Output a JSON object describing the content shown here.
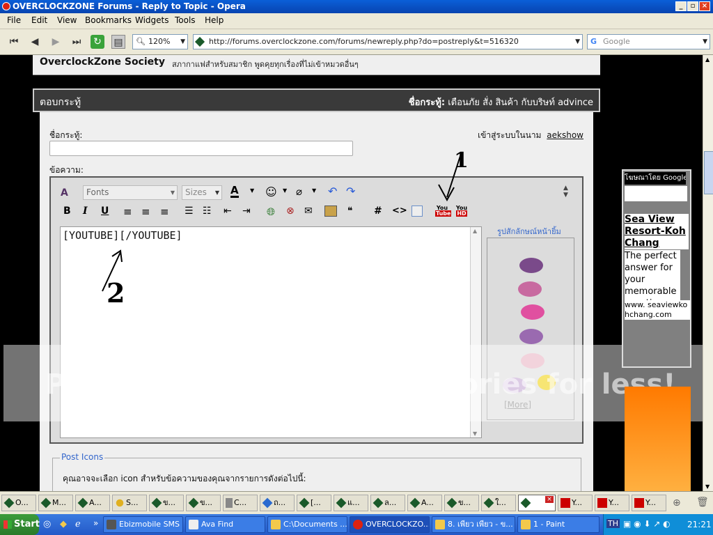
{
  "window": {
    "title": "OVERCLOCKZONE Forums - Reply to Topic - Opera"
  },
  "menu": [
    "File",
    "Edit",
    "View",
    "Bookmarks",
    "Widgets",
    "Tools",
    "Help"
  ],
  "toolbar": {
    "zoom": "120%",
    "url": "http://forums.overclockzone.com/forums/newreply.php?do=postreply&t=516320",
    "search_placeholder": "Google"
  },
  "forum": {
    "society_name": "OverclockZone Society",
    "society_desc": "สภากาแฟสำหรับสมาชิก พูดคุยทุกเรื่องที่ไม่เข้าหมวดอื่นๆ",
    "reply_header": "ตอบกระทู้",
    "topic_label": "ชื่อกระทู้:",
    "topic_name": "เตือนภัย สั่ง สินค้า กับบริษท์ advince",
    "title_label": "ชื่อกระทู้:",
    "login_text": "เข้าสู่ระบบในนาม",
    "username": "aekshow",
    "message_label": "ข้อความ:",
    "fonts_label": "Fonts",
    "sizes_label": "Sizes",
    "editor_text": "[YOUTUBE][/YOUTUBE]",
    "smilies_title": "รูปสักลักษณ์หน้ายิ้ม",
    "more_link": "[More]",
    "post_icons_label": "Post Icons",
    "post_icons_desc": "คุณอาจจะเลือก icon สำหรับข้อความของคุณจากรายการดังต่อไปนี้:",
    "annotation_1": "1",
    "annotation_2": "2"
  },
  "ad": {
    "header": "โฆษณาโดย Google",
    "title": "Sea View Resort-Koh Chang",
    "body": "The perfect answer for your memorable vacation.",
    "url": "www. seaviewkohchang.com"
  },
  "watermark": {
    "text": "Protect more of your memories for less!"
  },
  "tabs": [
    {
      "label": "O..."
    },
    {
      "label": "M..."
    },
    {
      "label": "A..."
    },
    {
      "label": "S..."
    },
    {
      "label": "ข..."
    },
    {
      "label": "ข..."
    },
    {
      "label": "C..."
    },
    {
      "label": "ถ..."
    },
    {
      "label": "[..."
    },
    {
      "label": "แ..."
    },
    {
      "label": "ล..."
    },
    {
      "label": "A..."
    },
    {
      "label": "ข..."
    },
    {
      "label": "ใ..."
    },
    {
      "label": ""
    },
    {
      "label": "Y..."
    },
    {
      "label": "Y..."
    },
    {
      "label": "Y..."
    }
  ],
  "taskbar": {
    "start": "Start",
    "items": [
      "Ebizmobile SMS ...",
      "Ava Find",
      "C:\\Documents ...",
      "OVERCLOCKZO...",
      "8. เพียว เพียว - ข...",
      "1 - Paint"
    ],
    "lang": "TH",
    "clock": "21:21"
  },
  "colors": {
    "accent": "#2459c8",
    "forum_header": "#3a3a3a",
    "link": "#3366cc",
    "ad_bg": "#808080"
  }
}
